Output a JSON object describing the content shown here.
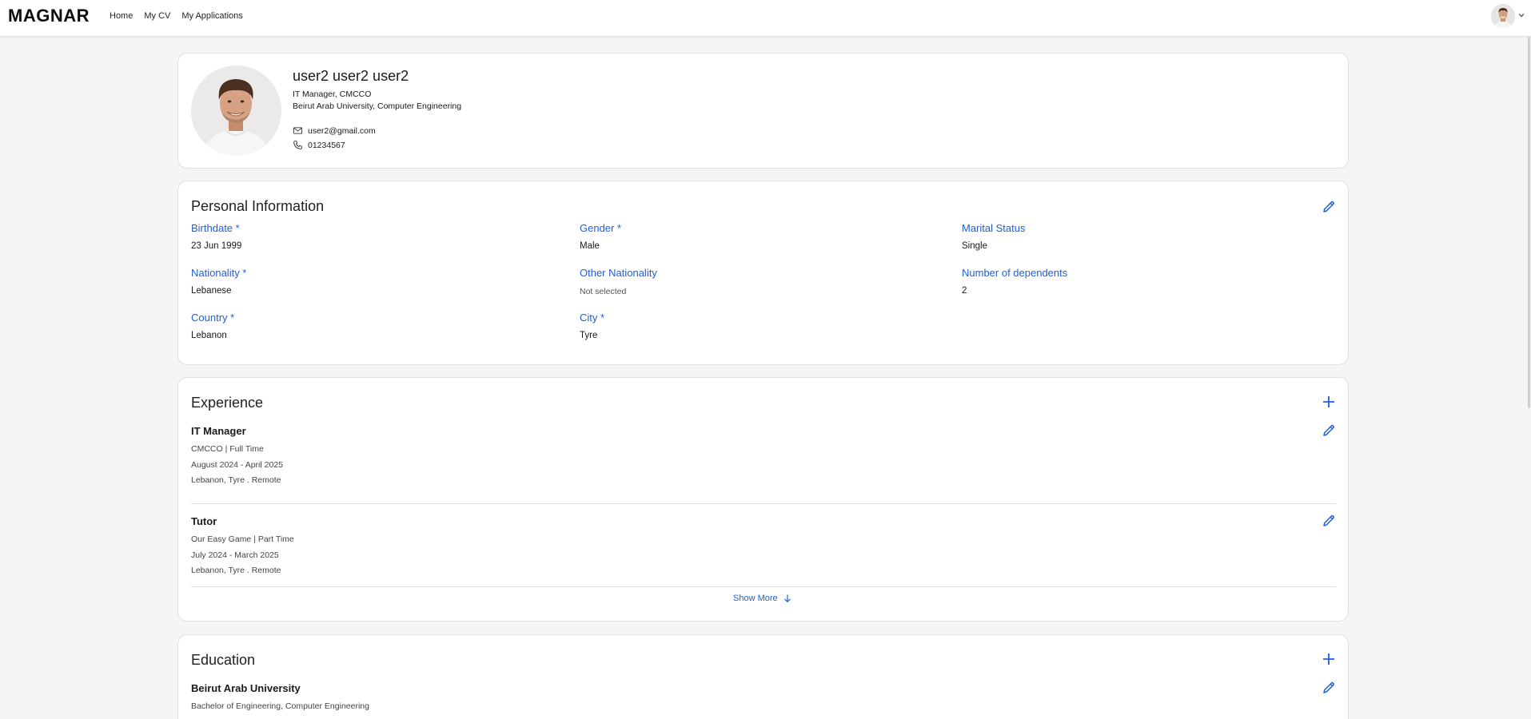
{
  "nav": {
    "logo": "MAGNAR",
    "links": [
      "Home",
      "My CV",
      "My Applications"
    ]
  },
  "profile": {
    "name": "user2 user2 user2",
    "role": "IT Manager, CMCCO",
    "education": "Beirut Arab University, Computer Engineering",
    "email": "user2@gmail.com",
    "phone": "01234567"
  },
  "personal": {
    "title": "Personal Information",
    "fields": [
      {
        "label": "Birthdate *",
        "value": "23 Jun 1999"
      },
      {
        "label": "Gender *",
        "value": "Male"
      },
      {
        "label": "Marital Status",
        "value": "Single"
      },
      {
        "label": "Nationality *",
        "value": "Lebanese"
      },
      {
        "label": "Other Nationality",
        "value": "Not selected"
      },
      {
        "label": "Number of dependents",
        "value": "2"
      },
      {
        "label": "Country *",
        "value": "Lebanon"
      },
      {
        "label": "City *",
        "value": "Tyre"
      }
    ]
  },
  "experience": {
    "title": "Experience",
    "items": [
      {
        "title": "IT Manager",
        "company": "CMCCO | Full Time",
        "dates": "August 2024 - April 2025",
        "location": "Lebanon, Tyre . Remote"
      },
      {
        "title": "Tutor",
        "company": "Our Easy Game | Part Time",
        "dates": "July 2024 - March 2025",
        "location": "Lebanon, Tyre . Remote"
      }
    ],
    "show_more": "Show More"
  },
  "education": {
    "title": "Education",
    "items": [
      {
        "title": "Beirut Arab University",
        "degree": "Bachelor of Engineering, Computer Engineering"
      }
    ]
  },
  "colors": {
    "accent": "#1f5fd6",
    "background": "#f5f5f5",
    "card": "#ffffff"
  }
}
